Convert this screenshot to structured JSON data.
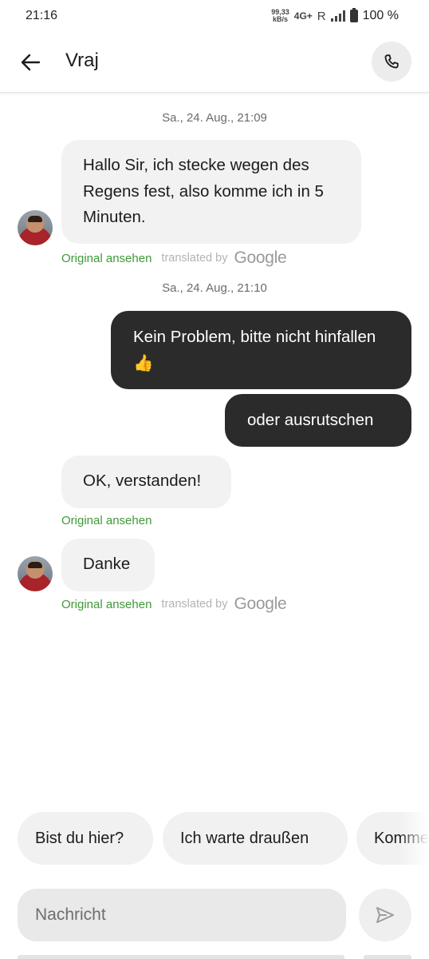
{
  "status_bar": {
    "time": "21:16",
    "net_speed_value": "99,33",
    "net_speed_unit": "kB/s",
    "network": "4G+",
    "roaming": "R",
    "battery": "100 %"
  },
  "header": {
    "contact_name": "Vraj"
  },
  "messages": [
    {
      "type": "timestamp",
      "text": "Sa., 24. Aug., 21:09"
    },
    {
      "type": "incoming",
      "text": "Hallo Sir, ich stecke wegen des Regens fest, also komme ich in 5 Minuten.",
      "original_link": "Original ansehen",
      "translated_by": "translated by",
      "translator": "Google"
    },
    {
      "type": "timestamp",
      "text": "Sa., 24. Aug., 21:10"
    },
    {
      "type": "outgoing",
      "text": "Kein Problem, bitte nicht hinfallen 👍"
    },
    {
      "type": "outgoing",
      "text": "oder ausrutschen"
    },
    {
      "type": "incoming",
      "text": "OK, verstanden!",
      "original_link": "Original ansehen"
    },
    {
      "type": "incoming",
      "text": "Danke",
      "original_link": "Original ansehen",
      "translated_by": "translated by",
      "translator": "Google"
    }
  ],
  "quick_replies": [
    "Bist du hier?",
    "Ich warte draußen",
    "Komme gleich"
  ],
  "composer": {
    "placeholder": "Nachricht",
    "value": ""
  },
  "icons": {
    "back": "arrow-left-icon",
    "call": "phone-icon",
    "send": "send-icon"
  },
  "colors": {
    "outgoing_bubble": "#2b2b2b",
    "incoming_bubble": "#f2f2f2",
    "link_green": "#3e9a37"
  }
}
